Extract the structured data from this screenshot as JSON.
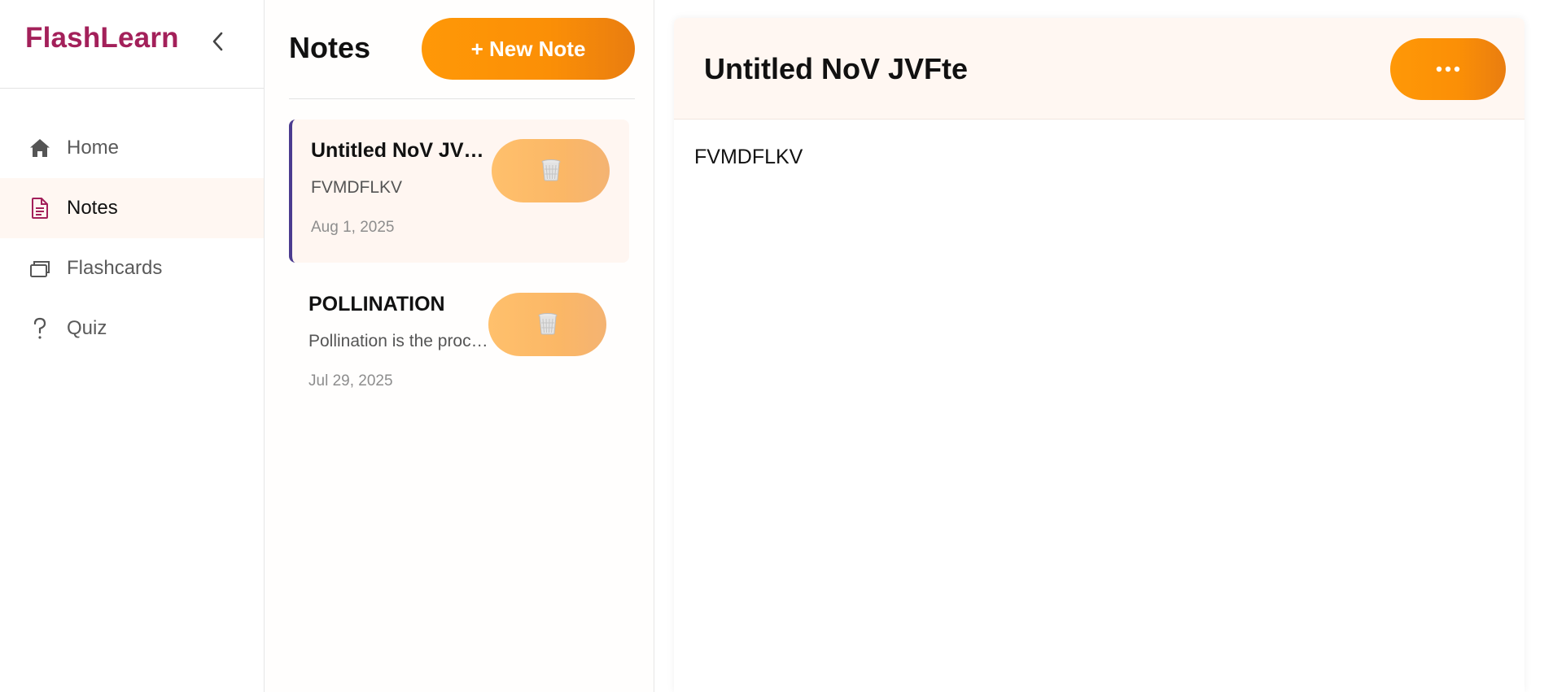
{
  "sidebar": {
    "brand": "FlashLearn",
    "collapse_icon": "chevron-left-icon",
    "items": [
      {
        "label": "Home",
        "icon": "home-icon",
        "active": false
      },
      {
        "label": "Notes",
        "icon": "document-icon",
        "active": true
      },
      {
        "label": "Flashcards",
        "icon": "cards-icon",
        "active": false
      },
      {
        "label": "Quiz",
        "icon": "question-icon",
        "active": false
      }
    ]
  },
  "notes_list": {
    "title": "Notes",
    "new_note_label": "+ New Note",
    "notes": [
      {
        "title": "Untitled NoV JVFte",
        "preview": "FVMDFLKV",
        "date": "Aug 1, 2025",
        "active": true
      },
      {
        "title": "POLLINATION",
        "preview": "Pollination is the process of transferring pollen",
        "date": "Jul 29, 2025",
        "active": false
      }
    ],
    "delete_icon": "trash-icon"
  },
  "editor": {
    "title": "Untitled NoV JVFte",
    "more_icon": "more-horizontal-icon",
    "content": "FVMDFLKV"
  },
  "colors": {
    "brand": "#a3205a",
    "accent": "#ff9807",
    "active_bg": "#fff7f2",
    "active_border": "#4b3b8f"
  }
}
